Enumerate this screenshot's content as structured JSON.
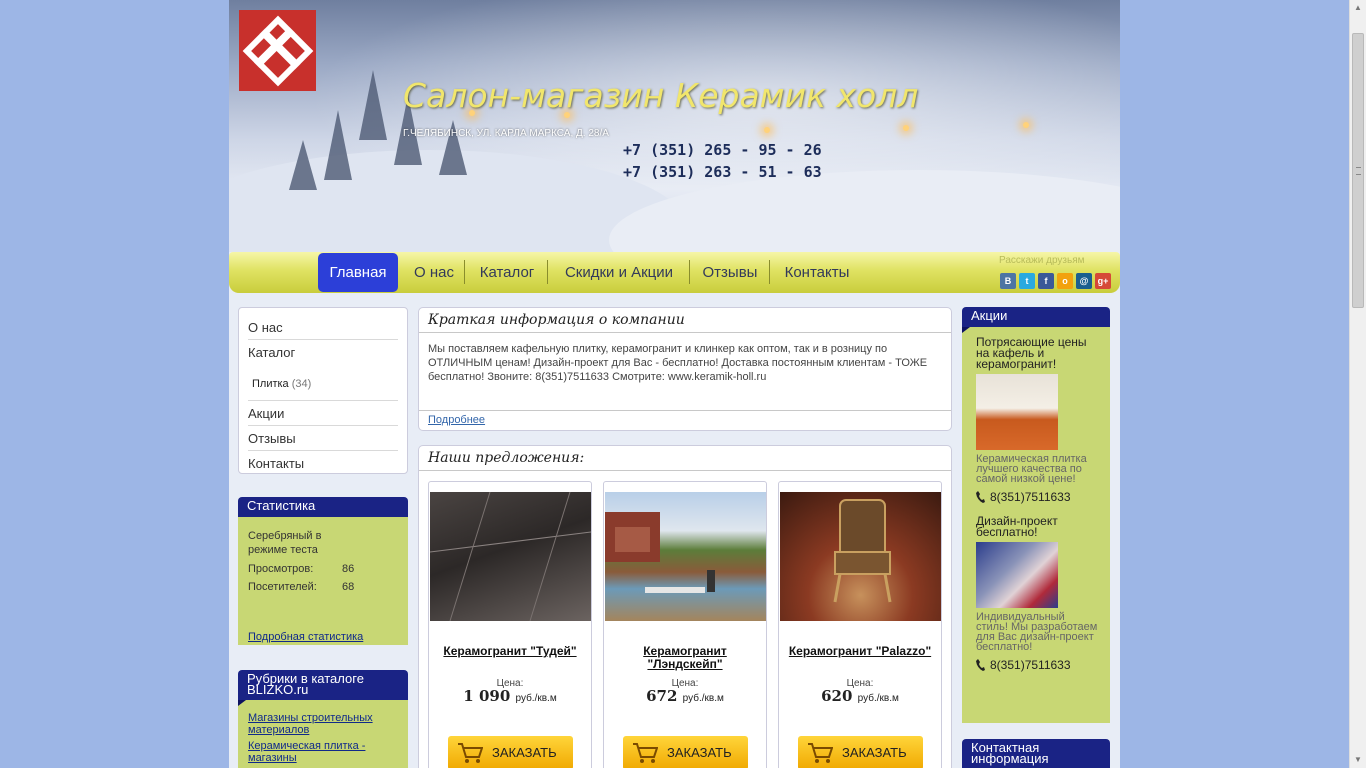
{
  "header": {
    "title": "Салон-магазин Керамик холл",
    "address": "Г.ЧЕЛЯБИНСК, УЛ. КАРЛА МАРКСА, Д. 28/А",
    "phones": [
      "+7 (351) 265 - 95 - 26",
      "+7 (351) 263 - 51 - 63"
    ]
  },
  "nav": {
    "items": [
      "Главная",
      "О нас",
      "Каталог",
      "Скидки и Акции",
      "Отзывы",
      "Контакты"
    ],
    "active": "Главная",
    "share_label": "Расскажи друзьям",
    "share_icons": [
      "vkontakte-icon",
      "twitter-icon",
      "facebook-icon",
      "odnoklassniki-icon",
      "mailru-icon",
      "googleplus-icon"
    ]
  },
  "leftmenu": {
    "about": "О нас",
    "catalog": "Каталог",
    "sub_label": "Плитка",
    "sub_count": "(34)",
    "promos": "Акции",
    "reviews": "Отзывы",
    "contacts": "Контакты"
  },
  "stats": {
    "title": "Статистика",
    "status": "Серебряный в режиме теста",
    "views_label": "Просмотров:",
    "views": "86",
    "visitors_label": "Посетителей:",
    "visitors": "68",
    "more": "Подробная статистика"
  },
  "rubrics": {
    "title": "Рубрики в каталоге BLIZKO.ru",
    "links": [
      "Магазины строительных материалов",
      "Керамическая плитка - магазины"
    ]
  },
  "about": {
    "title": "Краткая информация о компании",
    "text": "Мы поставляем кафельную плитку, керамогранит и клинкер как оптом, так и в розницу по ОТЛИЧНЫМ ценам! Дизайн-проект для Вас - бесплатно! Доставка постоянным клиентам - ТОЖЕ бесплатно! Звоните: 8(351)7511633 Смотрите: www.keramik-holl.ru",
    "more": "Подробнее"
  },
  "offers": {
    "title": "Наши предложения:",
    "price_label": "Цена:",
    "unit": "руб./кв.м",
    "order_label": "ЗАКАЗАТЬ",
    "products": [
      {
        "name": "Керамогранит \"Тудей\"",
        "price": "1 090"
      },
      {
        "name": "Керамогранит \"Лэндскейп\"",
        "price": "672"
      },
      {
        "name": "Керамогранит \"Palazzo\"",
        "price": "620"
      }
    ]
  },
  "actions": {
    "title": "Акции",
    "promo1_title": "Потрясающие цены на кафель и керамогранит!",
    "promo1_desc": "Керамическая плитка лучшего качества по самой низкой цене!",
    "promo1_phone": "8(351)7511633",
    "promo2_title": "Дизайн-проект бесплатно!",
    "promo2_desc": "Индивидуальный стиль! Мы разработаем для Вас дизайн-проект бесплатно!",
    "promo2_phone": "8(351)7511633"
  },
  "contacts": {
    "title": "Контактная информация"
  },
  "colors": {
    "nav_active": "#2c3fd8",
    "block_head": "#1a2385",
    "block_body": "#c8d774",
    "title_yellow": "#f1e66c",
    "order_button": "#f0a800"
  }
}
